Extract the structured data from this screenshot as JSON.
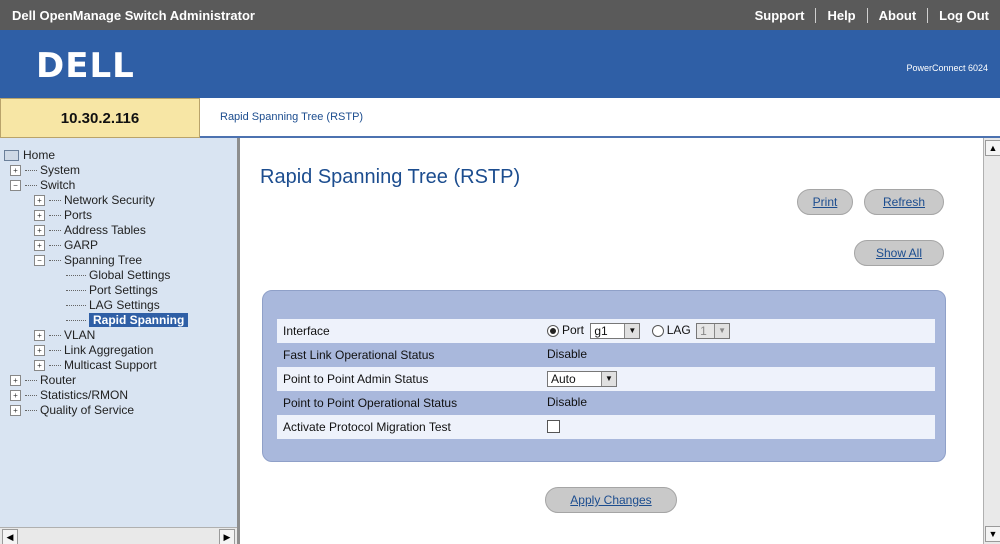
{
  "topbar": {
    "title": "Dell OpenManage Switch Administrator",
    "links": [
      "Support",
      "Help",
      "About",
      "Log Out"
    ]
  },
  "brand": {
    "logo": "DELL",
    "model": "PowerConnect 6024"
  },
  "ip": "10.30.2.116",
  "breadcrumb": "Rapid Spanning Tree (RSTP)",
  "nav": {
    "home": "Home",
    "system": "System",
    "switch": "Switch",
    "network_security": "Network Security",
    "ports": "Ports",
    "address_tables": "Address Tables",
    "garp": "GARP",
    "spanning_tree": "Spanning Tree",
    "global_settings": "Global Settings",
    "port_settings": "Port Settings",
    "lag_settings": "LAG Settings",
    "rapid_spanning": "Rapid Spanning",
    "vlan": "VLAN",
    "link_aggregation": "Link Aggregation",
    "multicast_support": "Multicast Support",
    "router": "Router",
    "statistics_rmon": "Statistics/RMON",
    "quality_of_service": "Quality of Service"
  },
  "page": {
    "title": "Rapid Spanning Tree (RSTP)",
    "buttons": {
      "print": "Print",
      "refresh": "Refresh",
      "show_all": "Show All",
      "apply": "Apply Changes"
    },
    "rows": {
      "interface_label": "Interface",
      "port_label": "Port",
      "port_value": "g1",
      "lag_label": "LAG",
      "lag_value": "1",
      "fast_link_label": "Fast Link Operational Status",
      "fast_link_value": "Disable",
      "p2p_admin_label": "Point to Point Admin Status",
      "p2p_admin_value": "Auto",
      "p2p_oper_label": "Point to Point Operational Status",
      "p2p_oper_value": "Disable",
      "migration_label": "Activate Protocol Migration Test"
    }
  }
}
